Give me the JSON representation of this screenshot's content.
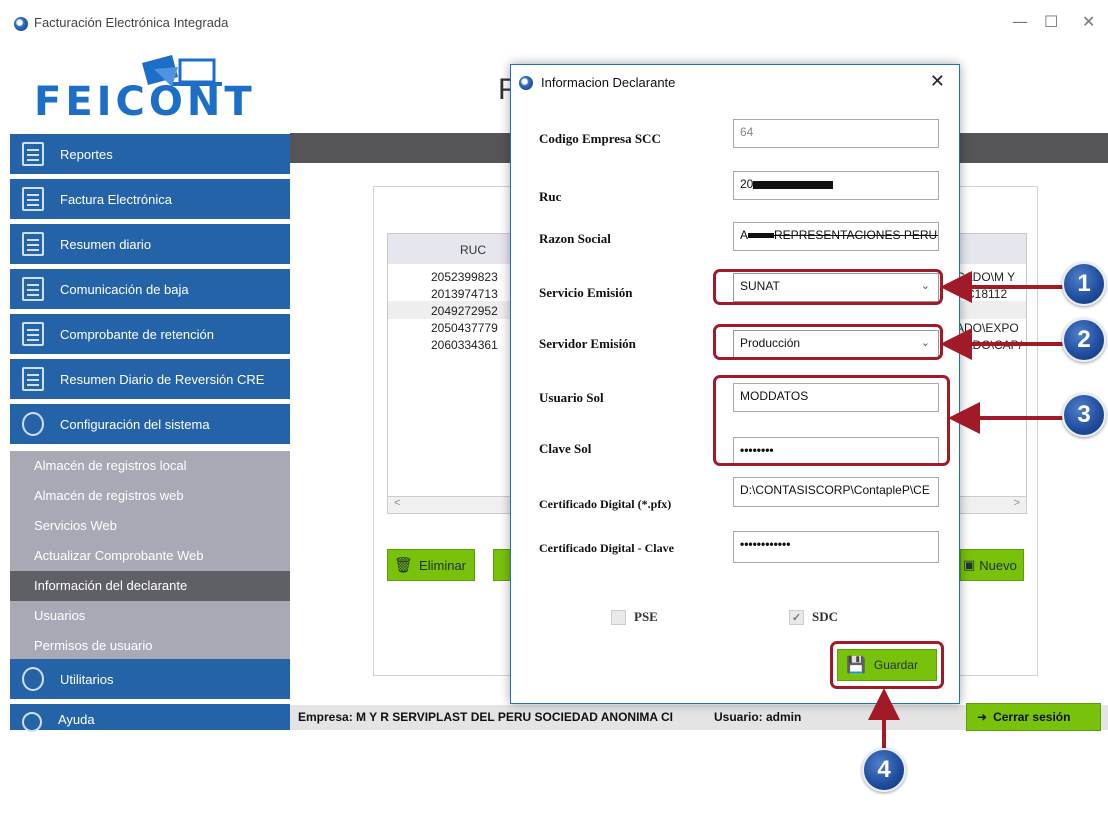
{
  "window": {
    "title": "Facturación Electrónica Integrada",
    "minimize": "—",
    "maximize": "☐",
    "close": "✕"
  },
  "logo": {
    "text": "FEICONT"
  },
  "header": {
    "title_partial": "F"
  },
  "sidebar": {
    "items": [
      {
        "label": "Reportes",
        "icon": "report-icon"
      },
      {
        "label": "Factura Electrónica",
        "icon": "invoice-icon"
      },
      {
        "label": "Resumen diario",
        "icon": "summary-icon"
      },
      {
        "label": "Comunicación de baja",
        "icon": "calendar-icon"
      },
      {
        "label": "Comprobante de retención",
        "icon": "percent-icon"
      },
      {
        "label": "Resumen Diario de Reversión CRE",
        "icon": "document-icon"
      },
      {
        "label": "Configuración del sistema",
        "icon": "gears-icon"
      }
    ],
    "subitems": [
      {
        "label": "Almacén de registros local"
      },
      {
        "label": "Almacén de registros web"
      },
      {
        "label": "Servicios Web"
      },
      {
        "label": "Actualizar Comprobante Web"
      },
      {
        "label": "Información del declarante",
        "active": true
      },
      {
        "label": "Usuarios"
      },
      {
        "label": "Permisos de usuario"
      }
    ],
    "bottom_items": [
      {
        "label": "Utilitarios",
        "icon": "tools-icon"
      },
      {
        "label": "Ayuda",
        "icon": "help-icon"
      }
    ]
  },
  "grid": {
    "header": "RUC",
    "rows": [
      {
        "ruc": "2052399823",
        "right": "CADO\\M Y"
      },
      {
        "ruc": "2013974713",
        "right": "n\\C18112"
      },
      {
        "ruc": "2049272952",
        "right": ""
      },
      {
        "ruc": "2050437779",
        "right": "ADO\\EXPO"
      },
      {
        "ruc": "2060334361",
        "right": "CADO\\CAP/"
      }
    ],
    "scroll_left": "<",
    "scroll_right": ">"
  },
  "buttons": {
    "eliminar": "Eliminar",
    "nuevo": "Nuevo"
  },
  "statusbar": {
    "empresa": "Empresa: M Y R SERVIPLAST DEL PERU SOCIEDAD ANONIMA CI",
    "usuario": "Usuario: admin",
    "cerrar": "Cerrar sesión"
  },
  "dialog": {
    "title": "Informacion Declarante",
    "close": "✕",
    "fields": {
      "codigo_label": "Codigo Empresa SCC",
      "codigo_value": "64",
      "ruc_label": "Ruc",
      "ruc_value": "20",
      "razon_label": "Razon Social",
      "razon_value_prefix": "A",
      "razon_value_suffix": "REPRESENTACIONES PERU S",
      "servicio_label": "Servicio Emisión",
      "servicio_value": "SUNAT",
      "servidor_label": "Servidor Emisión",
      "servidor_value": "Producción",
      "usuario_label": "Usuario Sol",
      "usuario_value": "MODDATOS",
      "clave_label": "Clave Sol",
      "clave_value": "••••••••",
      "cert_label": "Certificado Digital (*.pfx)",
      "cert_value": "D:\\CONTASISCORP\\ContapleP\\CE",
      "certclave_label": "Certificado Digital - Clave",
      "certclave_value": "••••••••••••"
    },
    "pse_label": "PSE",
    "sdc_label": "SDC",
    "guardar": "Guardar"
  },
  "callouts": [
    "1",
    "2",
    "3",
    "4"
  ],
  "colors": {
    "accent": "#2563a8",
    "green": "#79c20b",
    "highlight": "#a11a27",
    "badge": "#1e4b9b"
  }
}
